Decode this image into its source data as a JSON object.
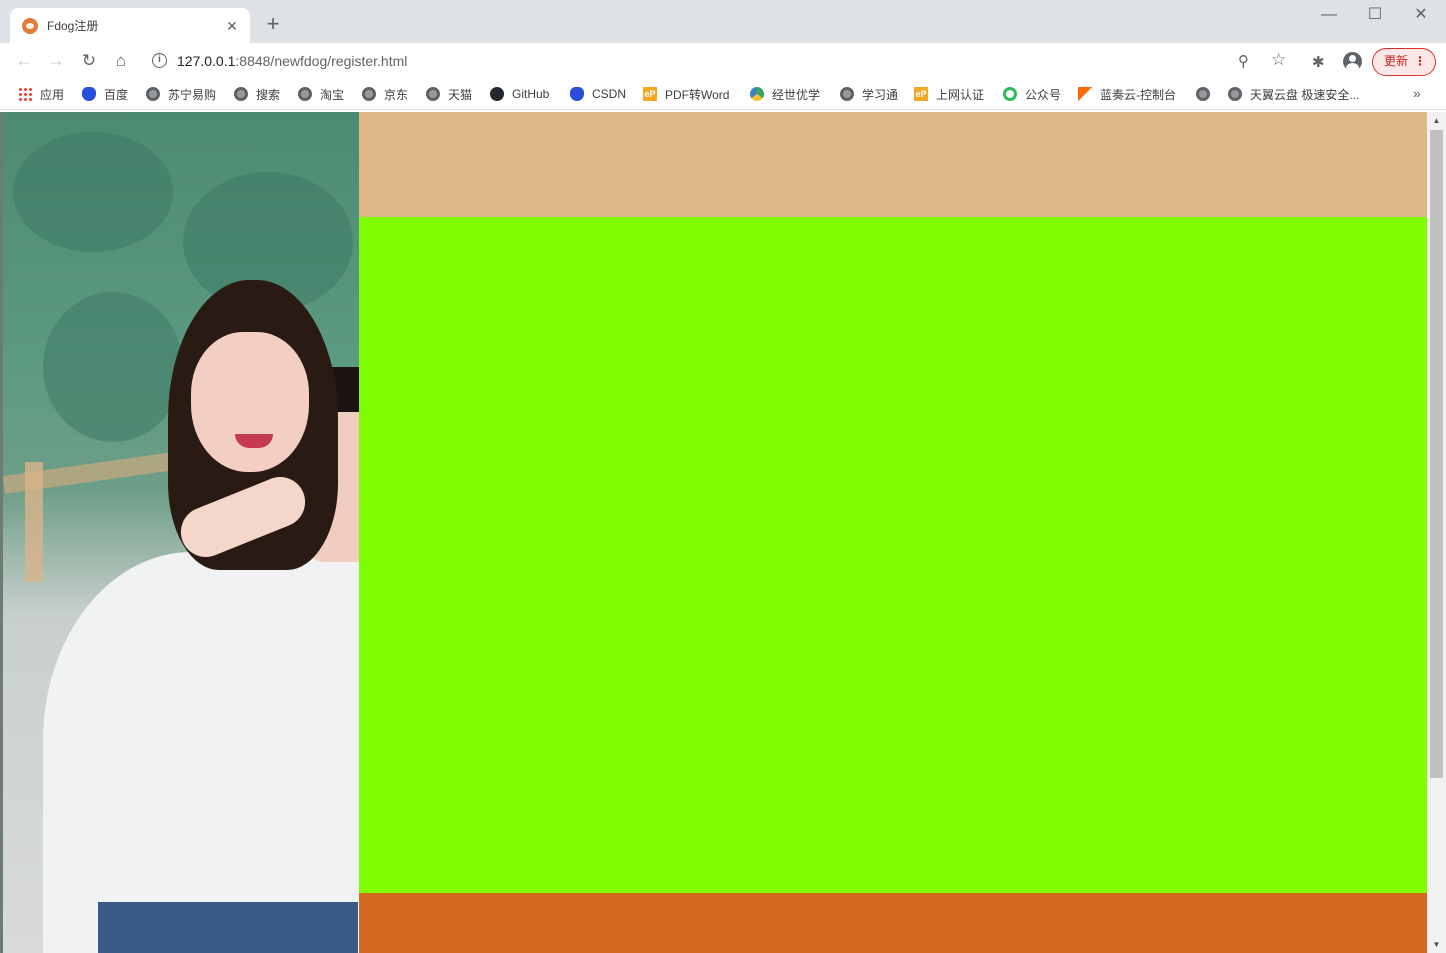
{
  "browser": {
    "tab": {
      "title": "Fdog注册",
      "close": "✕",
      "favicon": "fdog-favicon-icon"
    },
    "new_tab": "+",
    "window_controls": {
      "minimize": "—",
      "maximize": "☐",
      "close": "✕"
    },
    "nav": {
      "back": "←",
      "forward": "→",
      "reload": "↻",
      "home": "⌂"
    },
    "address": {
      "host": "127.0.0.1",
      "rest": ":8848/newfdog/register.html"
    },
    "toolbar_icons": {
      "zoom": "⚲",
      "star": "☆",
      "extensions": "✱"
    },
    "update_button": {
      "label": "更新",
      "menu": "⋮"
    },
    "bookmarks": [
      {
        "label": "应用",
        "icon": "apps-icon"
      },
      {
        "label": "百度",
        "icon": "baidu-paw-icon"
      },
      {
        "label": "苏宁易购",
        "icon": "globe-icon"
      },
      {
        "label": "搜索",
        "icon": "globe-icon"
      },
      {
        "label": "淘宝",
        "icon": "globe-icon"
      },
      {
        "label": "京东",
        "icon": "globe-icon"
      },
      {
        "label": "天猫",
        "icon": "globe-icon"
      },
      {
        "label": "GitHub",
        "icon": "github-icon"
      },
      {
        "label": "CSDN",
        "icon": "baidu-paw-icon"
      },
      {
        "label": "PDF转Word",
        "icon": "ep-icon"
      },
      {
        "label": "经世优学",
        "icon": "jingshi-icon"
      },
      {
        "label": "学习通",
        "icon": "globe-icon"
      },
      {
        "label": "上网认证",
        "icon": "ep-icon"
      },
      {
        "label": "公众号",
        "icon": "wechat-icon"
      },
      {
        "label": "蓝奏云-控制台",
        "icon": "lanzou-icon"
      },
      {
        "label": "",
        "icon": "globe-icon"
      },
      {
        "label": "天翼云盘 极速安全...",
        "icon": "globe-icon"
      }
    ],
    "bookmarks_more": "»",
    "ep_text": "eP"
  },
  "page": {
    "colors": {
      "header": "#deb887",
      "main": "#7fff00",
      "footer": "#d2691e"
    }
  },
  "scrollbar": {
    "up": "▲",
    "down": "▼"
  }
}
